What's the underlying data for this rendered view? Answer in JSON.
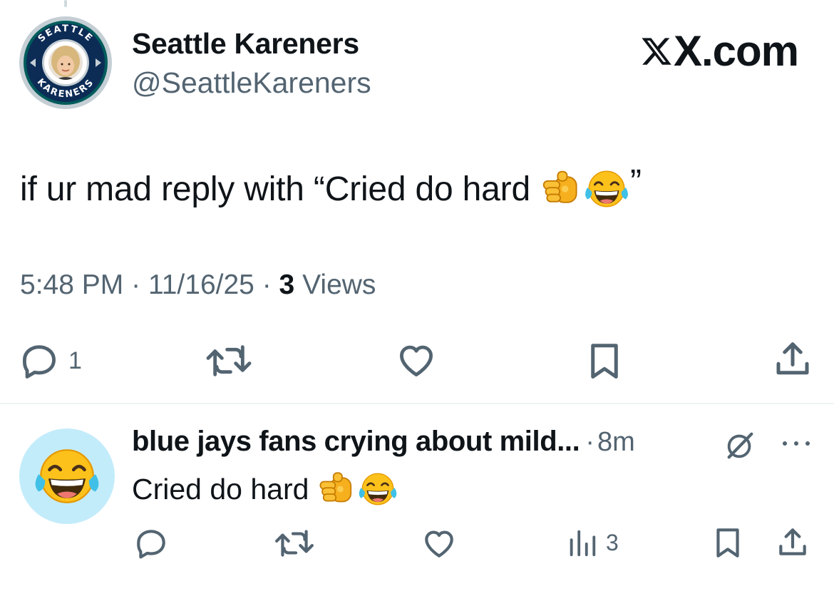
{
  "tweet": {
    "author": {
      "display_name": "Seattle Kareners",
      "handle": "@SeattleKareners",
      "avatar_ring_text_top": "SEATTLE",
      "avatar_ring_text_bottom": "KARENERS"
    },
    "brand": "X.com",
    "text": "if ur mad reply with “Cried do hard",
    "text_close_quote": "”",
    "emojis": [
      "backhand-pointing-fist",
      "tears-of-joy"
    ],
    "meta": {
      "time": "5:48 PM",
      "separator": "·",
      "date": "11/16/25",
      "views_count": "3",
      "views_label": "Views"
    },
    "actions": {
      "replies": "1",
      "reposts": "",
      "likes": ""
    }
  },
  "reply": {
    "display_name": "blue jays fans crying about mild...",
    "separator": "·",
    "time_ago": "8m",
    "text": "Cried do hard",
    "emojis": [
      "backhand-pointing-fist",
      "tears-of-joy"
    ],
    "actions": {
      "views": "3"
    }
  },
  "colors": {
    "text_primary": "#0f1419",
    "text_secondary": "#536471",
    "divider": "#eff3f4",
    "reply_avatar_bg": "#c3ecfb",
    "seattle_navy": "#0c2c56",
    "seattle_teal": "#005c5c",
    "seattle_silver": "#c4ced4"
  },
  "icons": [
    "reply-icon",
    "repost-icon",
    "like-icon",
    "bookmark-icon",
    "share-icon",
    "analytics-icon",
    "grok-icon",
    "more-icon",
    "x-logo-icon"
  ]
}
